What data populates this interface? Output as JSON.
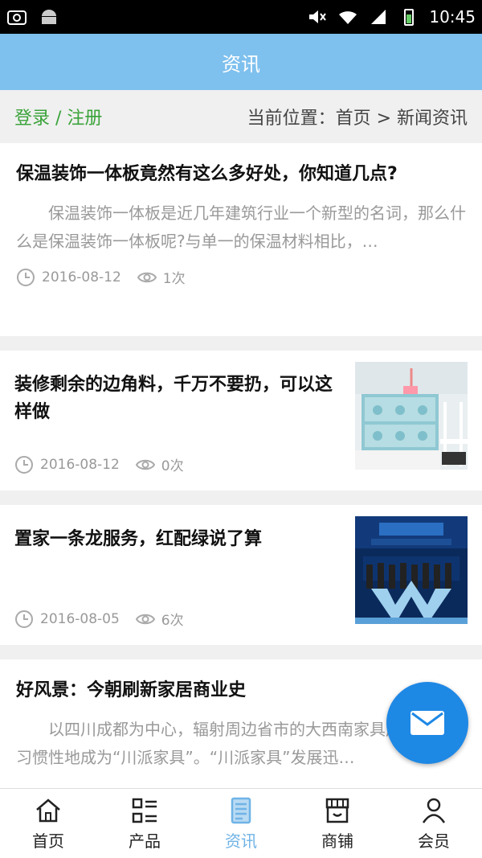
{
  "status_bar": {
    "time": "10:45"
  },
  "app_bar": {
    "title": "资讯"
  },
  "breadcrumb_bar": {
    "login_label": "登录 / 注册",
    "location": "当前位置：首页 > 新闻资讯"
  },
  "articles": [
    {
      "title": "保温装饰一体板竟然有这么多好处，你知道几点?",
      "summary": "保温装饰一体板是近几年建筑行业一个新型的名词，那么什么是保温装饰一体板呢?与单一的保温材料相比，…",
      "date": "2016-08-12",
      "views": "1次"
    },
    {
      "title": "装修剩余的边角料，千万不要扔，可以这样做",
      "date": "2016-08-12",
      "views": "0次"
    },
    {
      "title": "置家一条龙服务，红配绿说了算",
      "date": "2016-08-05",
      "views": "6次"
    },
    {
      "title": "好风景：今朝刷新家居商业史",
      "summary": "以四川成都为中心，辐射周边省市的大西南家具产业带，被习惯性地成为“川派家具”。“川派家具”发展迅…"
    }
  ],
  "tab_bar": {
    "items": [
      {
        "label": "首页",
        "icon": "home-icon"
      },
      {
        "label": "产品",
        "icon": "list-icon"
      },
      {
        "label": "资讯",
        "icon": "news-icon"
      },
      {
        "label": "商铺",
        "icon": "shop-icon"
      },
      {
        "label": "会员",
        "icon": "user-icon"
      }
    ]
  },
  "colors": {
    "app_bar": "#7ec0ee",
    "login": "#3aa33a",
    "fab": "#1e88e5",
    "active_tab": "#6fb3e6"
  }
}
